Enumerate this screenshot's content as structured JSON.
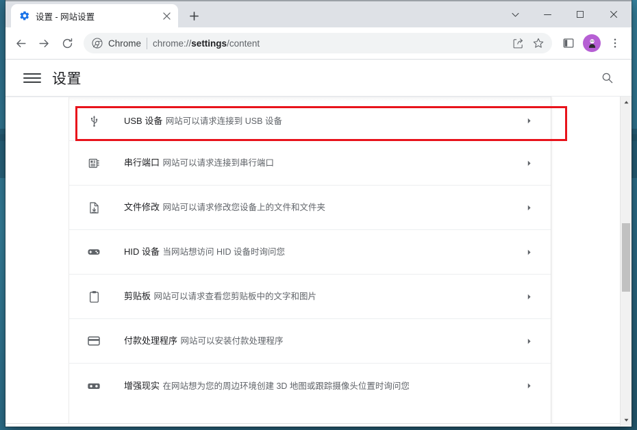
{
  "window": {
    "tab": {
      "title": "设置 - 网站设置",
      "favicon": "gear-icon",
      "close_label": "✕"
    },
    "new_tab_label": "+",
    "controls": {
      "tab_search_label": "tab-search-chevron",
      "minimize_label": "minimize",
      "maximize_label": "maximize",
      "close_label": "close"
    }
  },
  "toolbar": {
    "back_label": "back",
    "forward_label": "forward",
    "reload_label": "reload",
    "omnibox": {
      "scheme_label": "Chrome",
      "url_prefix": "chrome://",
      "url_bold": "settings",
      "url_suffix": "/content",
      "url_full": "chrome://settings/content"
    },
    "share_label": "share",
    "bookmark_label": "bookmark-star",
    "side_panel_label": "side-panel",
    "profile_label": "profile-avatar",
    "menu_label": "more-options"
  },
  "settings": {
    "menu_label": "主菜单",
    "title": "设置",
    "search_label": "搜索设置"
  },
  "permissions": {
    "rows": [
      {
        "id": "usb",
        "icon": "usb-icon",
        "title": "USB 设备",
        "subtitle": "网站可以请求连接到 USB 设备",
        "arrow": "chevron-right",
        "highlighted": true
      },
      {
        "id": "serial",
        "icon": "serial-port-icon",
        "title": "串行端口",
        "subtitle": "网站可以请求连接到串行端口",
        "arrow": "chevron-right",
        "highlighted": false
      },
      {
        "id": "file-edit",
        "icon": "file-edit-icon",
        "title": "文件修改",
        "subtitle": "网站可以请求修改您设备上的文件和文件夹",
        "arrow": "chevron-right",
        "highlighted": false
      },
      {
        "id": "hid",
        "icon": "hid-device-icon",
        "title": "HID 设备",
        "subtitle": "当网站想访问 HID 设备时询问您",
        "arrow": "chevron-right",
        "highlighted": false
      },
      {
        "id": "clipboard",
        "icon": "clipboard-icon",
        "title": "剪贴板",
        "subtitle": "网站可以请求查看您剪贴板中的文字和图片",
        "arrow": "chevron-right",
        "highlighted": false
      },
      {
        "id": "payment-handler",
        "icon": "credit-card-icon",
        "title": "付款处理程序",
        "subtitle": "网站可以安装付款处理程序",
        "arrow": "chevron-right",
        "highlighted": false
      },
      {
        "id": "augmented-reality",
        "icon": "vr-goggles-icon",
        "title": "增强现实",
        "subtitle": "在网站想为您的周边环境创建 3D 地图或跟踪摄像头位置时询问您",
        "arrow": "chevron-right",
        "highlighted": false
      }
    ]
  },
  "scrollbar": {
    "up_label": "▲",
    "down_label": "▼"
  },
  "colors": {
    "highlight": "#e8131b",
    "desktop": "#2f7691",
    "tabstrip": "#dee1e6",
    "accent": "#1a73e8",
    "avatar": "#b65fd4"
  }
}
